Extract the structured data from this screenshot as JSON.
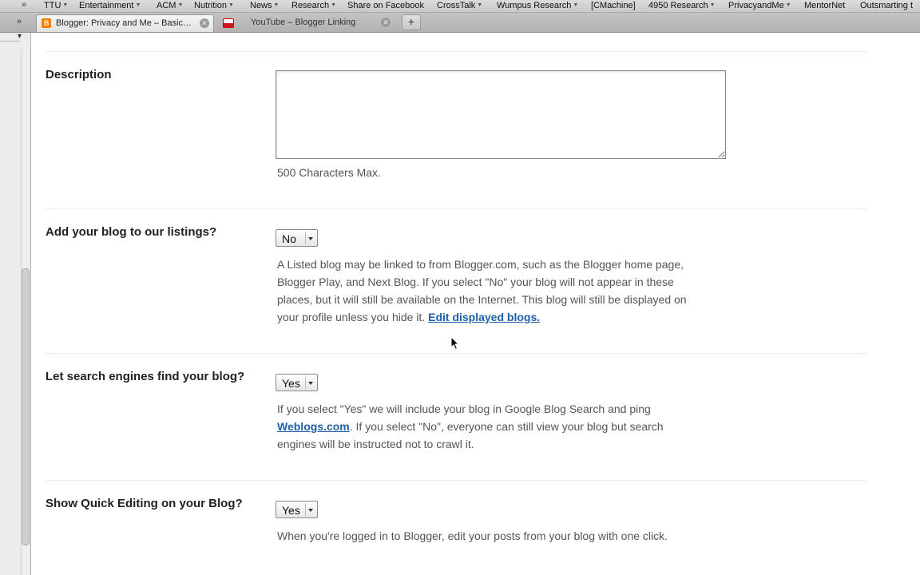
{
  "bookmarks": {
    "items": [
      {
        "label": "TTU",
        "dropdown": true
      },
      {
        "label": "Entertainment",
        "dropdown": true
      },
      {
        "label": "ACM",
        "dropdown": true
      },
      {
        "label": "Nutrition",
        "dropdown": true
      },
      {
        "label": "News",
        "dropdown": true
      },
      {
        "label": "Research",
        "dropdown": true
      },
      {
        "label": "Share on Facebook",
        "dropdown": false
      },
      {
        "label": "CrossTalk",
        "dropdown": true
      },
      {
        "label": "Wumpus Research",
        "dropdown": true
      },
      {
        "label": "[CMachine]",
        "dropdown": false
      },
      {
        "label": "4950 Research",
        "dropdown": true
      },
      {
        "label": "PrivacyandMe",
        "dropdown": true
      },
      {
        "label": "MentorNet",
        "dropdown": false
      },
      {
        "label": "Outsmarting t",
        "dropdown": false
      }
    ]
  },
  "tabs": [
    {
      "label": "Blogger: Privacy and Me – Basic…",
      "active": true,
      "icon": "blogger-icon"
    },
    {
      "label": "YouTube – Blogger Linking",
      "active": false,
      "icon": "youtube-icon"
    }
  ],
  "new_tab_label": "+",
  "settings": {
    "description": {
      "label": "Description",
      "value": "",
      "hint": "500 Characters Max."
    },
    "listings": {
      "label": "Add your blog to our listings?",
      "selected": "No",
      "help_text": "A Listed blog may be linked to from Blogger.com, such as the Blogger home page, Blogger Play, and Next Blog. If you select \"No\" your blog will not appear in these places, but it will still be available on the Internet. This blog will still be displayed on your profile unless you hide it.",
      "link_text": "Edit displayed blogs."
    },
    "search_engines": {
      "label": "Let search engines find your blog?",
      "selected": "Yes",
      "help_before": "If you select \"Yes\" we will include your blog in Google Blog Search and ping",
      "link_text": "Weblogs.com",
      "help_after": ". If you select \"No\", everyone can still view your blog but search engines will be instructed not to crawl it."
    },
    "quick_editing": {
      "label": "Show Quick Editing on your Blog?",
      "selected": "Yes",
      "help_text": "When you're logged in to Blogger, edit your posts from your blog with one click."
    }
  },
  "colors": {
    "link": "#1f5fa8",
    "label": "#222222",
    "help": "#555555"
  }
}
